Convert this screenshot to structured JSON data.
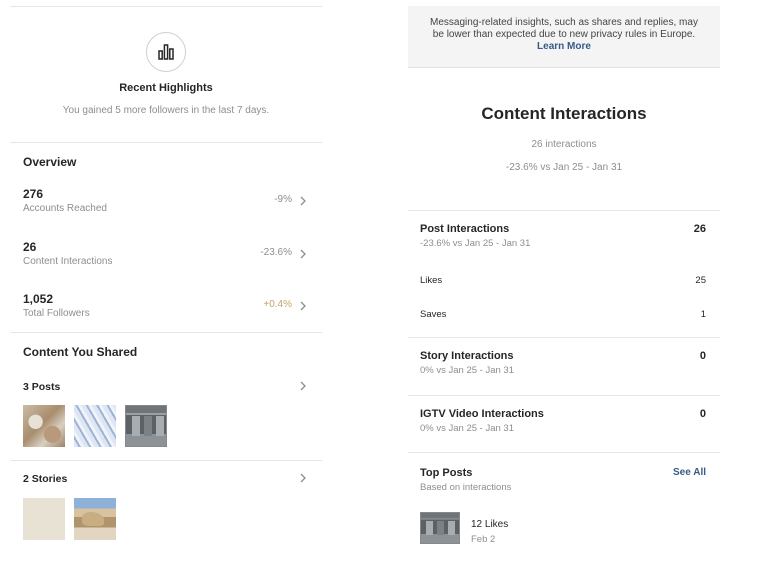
{
  "left": {
    "highlights": {
      "icon": "bar-chart-icon",
      "title": "Recent Highlights",
      "subtitle": "You gained 5 more followers in the last 7 days."
    },
    "overview": {
      "title": "Overview",
      "metrics": [
        {
          "value": "276",
          "label": "Accounts Reached",
          "change": "-9%"
        },
        {
          "value": "26",
          "label": "Content Interactions",
          "change": "-23.6%"
        },
        {
          "value": "1,052",
          "label": "Total Followers",
          "change": "+0.4%"
        }
      ]
    },
    "content": {
      "title": "Content You Shared",
      "posts_label": "3 Posts",
      "stories_label": "2 Stories"
    }
  },
  "right": {
    "notice": {
      "text": "Messaging-related insights, such as shares and replies, may be lower than expected due to new privacy rules in Europe.",
      "link": "Learn More"
    },
    "title": "Content Interactions",
    "interactions": "26 interactions",
    "comparison": "-23.6% vs Jan 25 - Jan 31",
    "post_interactions": {
      "title": "Post Interactions",
      "sub": "-23.6% vs Jan 25 - Jan 31",
      "value": "26",
      "rows": [
        {
          "label": "Likes",
          "value": "25"
        },
        {
          "label": "Saves",
          "value": "1"
        }
      ]
    },
    "story_interactions": {
      "title": "Story Interactions",
      "sub": "0% vs Jan 25 - Jan 31",
      "value": "0"
    },
    "igtv_interactions": {
      "title": "IGTV Video Interactions",
      "sub": "0% vs Jan 25 - Jan 31",
      "value": "0"
    },
    "top_posts": {
      "title": "Top Posts",
      "sub": "Based on interactions",
      "see_all": "See All",
      "post": {
        "likes": "12 Likes",
        "date": "Feb 2"
      }
    }
  },
  "colors": {
    "positive_change": "#c4a266",
    "link": "#375a8a",
    "muted_text": "#8e8e8e"
  }
}
